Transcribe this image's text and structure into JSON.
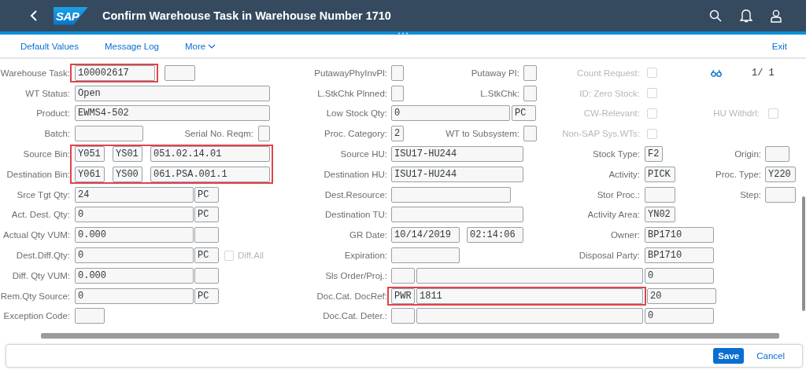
{
  "header": {
    "logo": "SAP",
    "title": "Confirm Warehouse Task in Warehouse Number 1710"
  },
  "toolbar": {
    "items": [
      "Default Values",
      "Message Log",
      "More"
    ],
    "exit": "Exit"
  },
  "form": {
    "rows": [
      {
        "groups": [
          {
            "kind": "field",
            "label": "Warehouse Task:",
            "highlighted": true,
            "fields": [
              {
                "kind": "input",
                "value": "100002617"
              }
            ]
          },
          {
            "kind": "field",
            "fields": [
              {
                "kind": "input"
              }
            ]
          },
          {
            "kind": "field",
            "label": "PutawayPhyInvPl:",
            "fields": [
              {
                "kind": "input"
              }
            ]
          },
          {
            "kind": "field",
            "label": "Putaway PI:",
            "fields": [
              {
                "kind": "input"
              }
            ]
          },
          {
            "kind": "field",
            "label": "Count Request:",
            "disabled": true,
            "fields": [
              {
                "kind": "checkbox",
                "checked": false
              }
            ]
          },
          {
            "kind": "pager",
            "text": "1/ 1"
          }
        ]
      },
      {
        "groups": [
          {
            "kind": "field",
            "label": "WT Status:",
            "fields": [
              {
                "kind": "input",
                "value": "Open"
              }
            ]
          },
          {
            "kind": "field",
            "label": "L.StkChk Plnned:",
            "fields": [
              {
                "kind": "input"
              }
            ]
          },
          {
            "kind": "field",
            "label": "L.StkChk:",
            "fields": [
              {
                "kind": "input"
              }
            ]
          },
          {
            "kind": "field",
            "label": "ID: Zero Stock:",
            "disabled": true,
            "fields": [
              {
                "kind": "checkbox",
                "checked": false
              }
            ]
          }
        ]
      },
      {
        "groups": [
          {
            "kind": "field",
            "label": "Product:",
            "fields": [
              {
                "kind": "input",
                "value": "EWMS4-502"
              }
            ]
          },
          {
            "kind": "field",
            "label": "Low Stock Qty:",
            "fields": [
              {
                "kind": "input",
                "value": "0"
              },
              {
                "kind": "input",
                "value": "PC"
              }
            ]
          },
          {
            "kind": "field",
            "label": "CW-Relevant:",
            "disabled": true,
            "fields": [
              {
                "kind": "checkbox",
                "checked": false
              }
            ]
          },
          {
            "kind": "field",
            "label": "HU Withdrl:",
            "disabled": true,
            "fields": [
              {
                "kind": "checkbox",
                "checked": false
              }
            ]
          }
        ]
      },
      {
        "groups": [
          {
            "kind": "field",
            "label": "Batch:",
            "fields": [
              {
                "kind": "input"
              }
            ]
          },
          {
            "kind": "field",
            "label": "Serial No. Reqm:",
            "fields": [
              {
                "kind": "input"
              }
            ]
          },
          {
            "kind": "field",
            "label": "Proc. Category:",
            "fields": [
              {
                "kind": "input",
                "value": "2"
              }
            ]
          },
          {
            "kind": "field",
            "label": "WT to Subsystem:",
            "fields": [
              {
                "kind": "input"
              }
            ]
          },
          {
            "kind": "field",
            "label": "Non-SAP Sys.WTs:",
            "disabled": true,
            "fields": [
              {
                "kind": "checkbox",
                "checked": false
              }
            ]
          }
        ]
      },
      {
        "groups": [
          {
            "kind": "field",
            "label": "Source Bin:",
            "highlighted": true,
            "fields": [
              {
                "kind": "input",
                "value": "Y051"
              },
              {
                "kind": "input",
                "value": "YS01"
              },
              {
                "kind": "input",
                "value": "051.02.14.01"
              }
            ]
          },
          {
            "kind": "field",
            "label": "Source HU:",
            "fields": [
              {
                "kind": "input",
                "value": "ISU17-HU244"
              }
            ]
          },
          {
            "kind": "field",
            "label": "Stock Type:",
            "fields": [
              {
                "kind": "input",
                "value": "F2"
              }
            ]
          },
          {
            "kind": "field",
            "label": "Origin:",
            "fields": [
              {
                "kind": "input"
              }
            ]
          }
        ]
      },
      {
        "groups": [
          {
            "kind": "field",
            "label": "Destination Bin:",
            "highlighted": true,
            "fields": [
              {
                "kind": "input",
                "value": "Y061"
              },
              {
                "kind": "input",
                "value": "YS00"
              },
              {
                "kind": "input",
                "value": "061.PSA.001.1"
              }
            ]
          },
          {
            "kind": "field",
            "label": "Destination HU:",
            "fields": [
              {
                "kind": "input",
                "value": "ISU17-HU244"
              }
            ]
          },
          {
            "kind": "field",
            "label": "Activity:",
            "fields": [
              {
                "kind": "input",
                "value": "PICK"
              }
            ]
          },
          {
            "kind": "field",
            "label": "Proc. Type:",
            "fields": [
              {
                "kind": "input",
                "value": "Y220"
              }
            ]
          }
        ]
      },
      {
        "groups": [
          {
            "kind": "field",
            "label": "Srce Tgt Qty:",
            "fields": [
              {
                "kind": "input",
                "value": "24"
              },
              {
                "kind": "input",
                "value": "PC"
              }
            ]
          },
          {
            "kind": "field",
            "label": "Dest.Resource:",
            "fields": [
              {
                "kind": "input"
              }
            ]
          },
          {
            "kind": "field",
            "label": "Stor Proc.:",
            "fields": [
              {
                "kind": "input"
              }
            ]
          },
          {
            "kind": "field",
            "label": "Step:",
            "fields": [
              {
                "kind": "input"
              }
            ]
          }
        ]
      },
      {
        "groups": [
          {
            "kind": "field",
            "label": "Act. Dest. Qty:",
            "fields": [
              {
                "kind": "input",
                "value": "0"
              },
              {
                "kind": "input",
                "value": "PC"
              }
            ]
          },
          {
            "kind": "field",
            "label": "Destination TU:",
            "fields": [
              {
                "kind": "input"
              }
            ]
          },
          {
            "kind": "field",
            "label": "Activity Area:",
            "fields": [
              {
                "kind": "input",
                "value": "YN02"
              }
            ]
          }
        ]
      },
      {
        "groups": [
          {
            "kind": "field",
            "label": "Actual Qty VUM:",
            "fields": [
              {
                "kind": "input",
                "value": "0.000"
              },
              {
                "kind": "input"
              }
            ]
          },
          {
            "kind": "field",
            "label": "GR Date:",
            "fields": [
              {
                "kind": "input",
                "value": "10/14/2019"
              },
              {
                "kind": "input",
                "value": "02:14:06"
              }
            ]
          },
          {
            "kind": "field",
            "label": "Owner:",
            "fields": [
              {
                "kind": "input",
                "value": "BP1710"
              }
            ]
          }
        ]
      },
      {
        "groups": [
          {
            "kind": "field",
            "label": "Dest.Diff.Qty:",
            "fields": [
              {
                "kind": "input",
                "value": "0"
              },
              {
                "kind": "input",
                "value": "PC"
              }
            ]
          },
          {
            "kind": "field",
            "disabled": true,
            "fields": [
              {
                "kind": "checkbox",
                "checked": false,
                "text": "Diff.All"
              }
            ]
          },
          {
            "kind": "field",
            "label": "Expiration:",
            "fields": [
              {
                "kind": "input"
              }
            ]
          },
          {
            "kind": "field",
            "label": "Disposal Party:",
            "fields": [
              {
                "kind": "input",
                "value": "BP1710"
              }
            ]
          }
        ]
      },
      {
        "groups": [
          {
            "kind": "field",
            "label": "Diff. Qty VUM:",
            "fields": [
              {
                "kind": "input",
                "value": "0.000"
              },
              {
                "kind": "input"
              }
            ]
          },
          {
            "kind": "field",
            "label": "Sls Order/Proj.:",
            "fields": [
              {
                "kind": "input"
              },
              {
                "kind": "input"
              },
              {
                "kind": "input",
                "value": "0"
              }
            ]
          }
        ]
      },
      {
        "groups": [
          {
            "kind": "field",
            "label": "Rem.Qty Source:",
            "fields": [
              {
                "kind": "input",
                "value": "0"
              },
              {
                "kind": "input",
                "value": "PC"
              }
            ]
          },
          {
            "kind": "field",
            "label": "Doc.Cat. DocRef:",
            "highlighted": true,
            "fields": [
              {
                "kind": "input",
                "value": "PWR"
              },
              {
                "kind": "input",
                "value": "1811"
              }
            ]
          },
          {
            "kind": "field",
            "fields": [
              {
                "kind": "input",
                "value": "20"
              }
            ]
          }
        ]
      },
      {
        "groups": [
          {
            "kind": "field",
            "label": "Exception Code:",
            "fields": [
              {
                "kind": "input"
              }
            ]
          },
          {
            "kind": "field",
            "label": "Doc.Cat. Deter.:",
            "fields": [
              {
                "kind": "input"
              },
              {
                "kind": "input"
              },
              {
                "kind": "input",
                "value": "0"
              }
            ]
          }
        ]
      }
    ]
  },
  "footer": {
    "save": "Save",
    "cancel": "Cancel"
  }
}
